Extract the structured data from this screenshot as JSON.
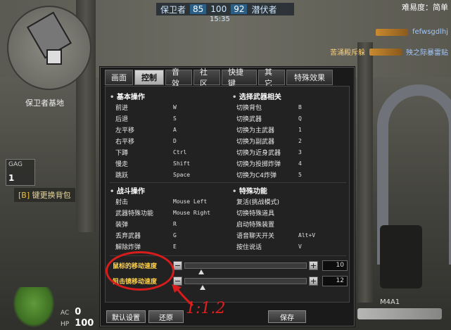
{
  "hud": {
    "team_left": "保卫者",
    "score_left": "85",
    "score_mid": "100",
    "score_right": "92",
    "team_right": "潜伏者",
    "timer": "15:35",
    "difficulty": "难易度：简单",
    "kill1_left": "",
    "kill1_right": "fefwsgdlhj",
    "kill2_left": "苦涌殿斥躲",
    "kill2_right": "殃之际暴雷贴"
  },
  "map": {
    "label": "保卫者基地"
  },
  "left_hud": {
    "grenade_label": "GAG",
    "grenade_count": "1",
    "bag_key": "[B]",
    "bag_text": "键更换背包",
    "ac_label": "AC",
    "ac_value": "0",
    "hp_label": "HP",
    "hp_value": "100"
  },
  "weapon": {
    "name": "M4A1"
  },
  "tabs": [
    {
      "label": "画面"
    },
    {
      "label": "控制"
    },
    {
      "label": "音效"
    },
    {
      "label": "社区"
    },
    {
      "label": "快捷键"
    },
    {
      "label": "其它"
    },
    {
      "label": "特殊效果"
    }
  ],
  "sections": {
    "basic": {
      "title": "基本操作",
      "rows": [
        {
          "label": "前进",
          "key": "W"
        },
        {
          "label": "后退",
          "key": "S"
        },
        {
          "label": "左平移",
          "key": "A"
        },
        {
          "label": "右平移",
          "key": "D"
        },
        {
          "label": "下蹲",
          "key": "Ctrl"
        },
        {
          "label": "慢走",
          "key": "Shift"
        },
        {
          "label": "跳跃",
          "key": "Space"
        }
      ]
    },
    "weapon_select": {
      "title": "选择武器相关",
      "rows": [
        {
          "label": "切换背包",
          "key": "B"
        },
        {
          "label": "切换武器",
          "key": "Q"
        },
        {
          "label": "切换为主武器",
          "key": "1"
        },
        {
          "label": "切换为副武器",
          "key": "2"
        },
        {
          "label": "切换为近身武器",
          "key": "3"
        },
        {
          "label": "切换为投掷炸弹",
          "key": "4"
        },
        {
          "label": "切换为C4炸弹",
          "key": "5"
        }
      ]
    },
    "combat": {
      "title": "战斗操作",
      "rows": [
        {
          "label": "射击",
          "key": "Mouse Left"
        },
        {
          "label": "武器特殊功能",
          "key": "Mouse Right"
        },
        {
          "label": "装弹",
          "key": "R"
        },
        {
          "label": "丢弃武器",
          "key": "G"
        },
        {
          "label": "解除炸弹",
          "key": "E"
        }
      ]
    },
    "special": {
      "title": "特殊功能",
      "rows": [
        {
          "label": "复活(挑战模式)",
          "key": ""
        },
        {
          "label": "切换特殊道具",
          "key": ""
        },
        {
          "label": "启动特殊装置",
          "key": ""
        },
        {
          "label": "语音聊天开关",
          "key": "Alt+V"
        },
        {
          "label": "按住说话",
          "key": "V"
        }
      ]
    }
  },
  "sliders": [
    {
      "label": "鼠标的移动速度",
      "value_text": "10",
      "level": 0.04
    },
    {
      "label": "狙击镜移动速度",
      "value_text": "12",
      "level": 0.05
    }
  ],
  "buttons": {
    "default": "默认设置",
    "restore": "还原",
    "save": "保存",
    "minus": "−",
    "plus": "+"
  },
  "annotation": {
    "text": "1:1.2",
    "color": "#e02020"
  }
}
